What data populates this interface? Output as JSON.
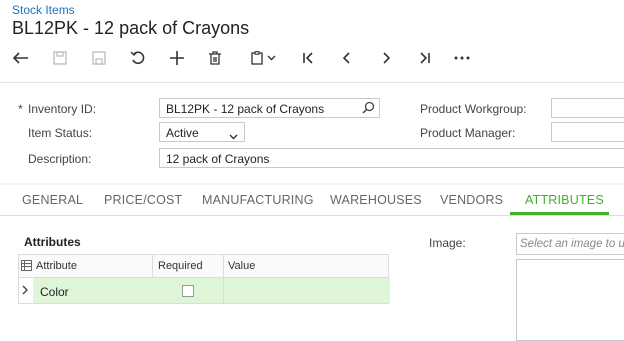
{
  "header": {
    "breadcrumb": "Stock Items",
    "title": "BL12PK - 12 pack of Crayons"
  },
  "toolbar": {
    "icons": [
      "undo-arrow-icon",
      "save-icon",
      "save-disabled-icon",
      "revert-icon",
      "add-icon",
      "delete-icon",
      "clipboard-icon",
      "first-icon",
      "prev-icon",
      "next-icon",
      "last-icon",
      "more-icon"
    ]
  },
  "form": {
    "inventory_id_label": "Inventory ID:",
    "required_mark": "*",
    "inventory_id_value": "BL12PK - 12 pack of Crayons",
    "item_status_label": "Item Status:",
    "item_status_value": "Active",
    "description_label": "Description:",
    "description_value": "12 pack of Crayons",
    "product_workgroup_label": "Product Workgroup:",
    "product_workgroup_value": "",
    "product_manager_label": "Product Manager:",
    "product_manager_value": ""
  },
  "tabs": [
    "GENERAL",
    "PRICE/COST",
    "MANUFACTURING",
    "WAREHOUSES",
    "VENDORS",
    "ATTRIBUTES"
  ],
  "active_tab": "ATTRIBUTES",
  "attributes": {
    "section_title": "Attributes",
    "columns": [
      "Attribute",
      "Required",
      "Value"
    ],
    "rows": [
      {
        "attribute": "Color",
        "required": false,
        "value": ""
      }
    ]
  },
  "image": {
    "label": "Image:",
    "placeholder": "Select an image to upload"
  },
  "colors": {
    "accent": "#43b02a",
    "link": "#1a73c6",
    "selected_row": "#dff5d8"
  }
}
